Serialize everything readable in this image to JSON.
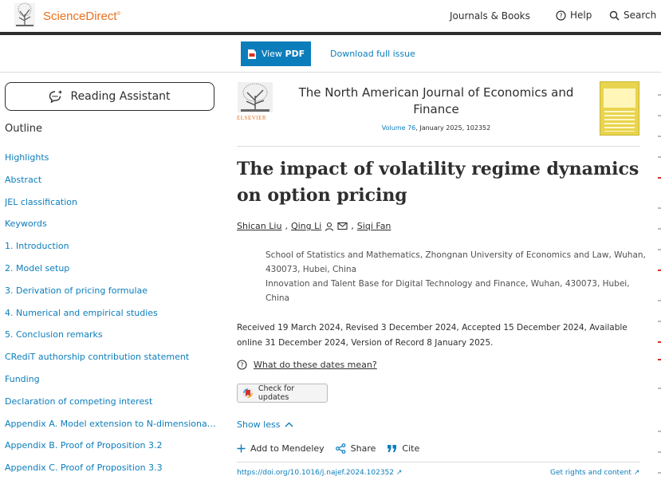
{
  "header": {
    "brand": "ScienceDirect",
    "brand_mark": "®",
    "nav_journals": "Journals & Books",
    "nav_help": "Help",
    "nav_search": "Search"
  },
  "pdfbar": {
    "view_pdf_prefix": "View",
    "view_pdf_bold": "PDF",
    "download_issue": "Download full issue"
  },
  "sidebar": {
    "reading_assistant": "Reading Assistant",
    "outline_title": "Outline",
    "items": [
      "Highlights",
      "Abstract",
      "JEL classification",
      "Keywords",
      "1. Introduction",
      "2. Model setup",
      "3. Derivation of pricing formulae",
      "4. Numerical and empirical studies",
      "5. Conclusion remarks",
      "CRediT authorship contribution statement",
      "Funding",
      "Declaration of competing interest",
      "Appendix A. Model extension to N-dimensional fr...",
      "Appendix B. Proof of Proposition 3.2",
      "Appendix C. Proof of Proposition 3.3"
    ]
  },
  "journal": {
    "publisher": "ELSEVIER",
    "title": "The North American Journal of Economics and Finance",
    "volume_link": "Volume 76",
    "volume_rest": ", January 2025, 102352"
  },
  "article": {
    "title": "The impact of volatility regime dynamics on option pricing",
    "authors": [
      "Shican Liu",
      "Qing Li",
      "Siqi Fan"
    ],
    "affiliations": [
      "School of Statistics and Mathematics, Zhongnan University of Economics and Law, Wuhan, 430073, Hubei, China",
      "Innovation and Talent Base for Digital Technology and Finance, Wuhan, 430073, Hubei, China"
    ],
    "dates": "Received 19 March 2024, Revised 3 December 2024, Accepted 15 December 2024, Available online 31 December 2024, Version of Record 8 January 2025.",
    "dates_question": "What do these dates mean?",
    "check_updates": "Check for updates",
    "show_less": "Show less",
    "add_mendeley": "Add to Mendeley",
    "share": "Share",
    "cite": "Cite",
    "doi": "https://doi.org/10.1016/j.najef.2024.102352",
    "rights": "Get rights and content"
  },
  "colors": {
    "accent": "#0c7dbb",
    "brand": "#e9711c",
    "text": "#2e2e2e"
  }
}
